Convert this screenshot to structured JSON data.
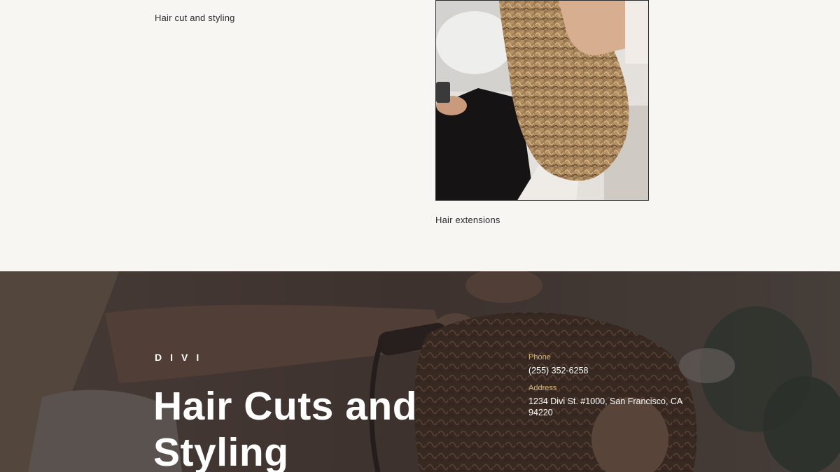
{
  "gallery": {
    "items": [
      {
        "caption": "Hair cut and styling"
      },
      {
        "caption": "Hair extensions",
        "image": "photo-curly-hair-salon"
      }
    ]
  },
  "hero": {
    "brand": "DIVI",
    "title": "Hair Cuts and Styling",
    "background_image": "photo-stylist-curling-hair",
    "contact": {
      "phone_label": "Phone",
      "phone_value": "(255) 352-6258",
      "address_label": "Address",
      "address_value": "1234 Divi St. #1000, San Francisco, CA 94220"
    }
  },
  "colors": {
    "page_background": "#f8f6f3",
    "hero_overlay": "#2e2624",
    "accent_gold": "#d8b46c",
    "text_dark": "#2b2b2b",
    "text_light": "#ffffff"
  }
}
